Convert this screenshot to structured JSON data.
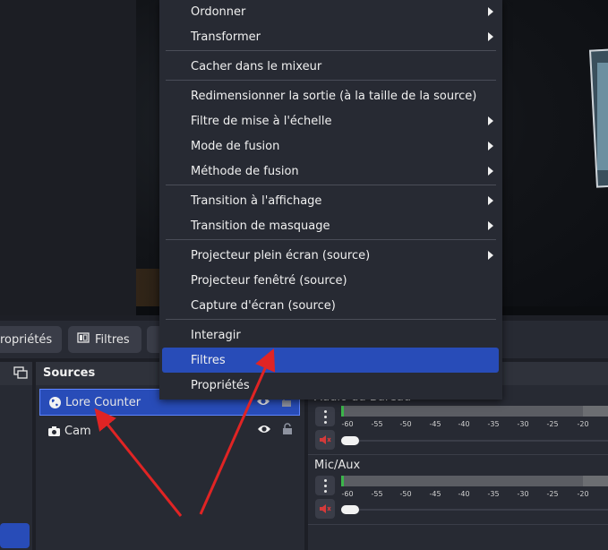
{
  "context_menu": {
    "items": [
      {
        "label": "Ordonner",
        "submenu": true
      },
      {
        "label": "Transformer",
        "submenu": true
      },
      {
        "label": "Cacher dans le mixeur",
        "submenu": false
      },
      {
        "label": "Redimensionner la sortie (à la taille de la source)",
        "submenu": false
      },
      {
        "label": "Filtre de mise à l'échelle",
        "submenu": true
      },
      {
        "label": "Mode de fusion",
        "submenu": true
      },
      {
        "label": "Méthode de fusion",
        "submenu": true
      },
      {
        "label": "Transition à l'affichage",
        "submenu": true
      },
      {
        "label": "Transition de masquage",
        "submenu": true
      },
      {
        "label": "Projecteur plein écran (source)",
        "submenu": true
      },
      {
        "label": "Projecteur fenêtré (source)",
        "submenu": false
      },
      {
        "label": "Capture d'écran (source)",
        "submenu": false
      },
      {
        "label": "Interagir",
        "submenu": false
      },
      {
        "label": "Filtres",
        "submenu": false,
        "active": true
      },
      {
        "label": "Propriétés",
        "submenu": false
      }
    ]
  },
  "toolbar": {
    "properties_label": "ropriétés",
    "filters_label": "Filtres"
  },
  "sources": {
    "title": "Sources",
    "items": [
      {
        "name": "Lore Counter",
        "icon": "browser-globe-icon",
        "selected": true
      },
      {
        "name": "Cam",
        "icon": "camera-icon",
        "selected": false
      }
    ]
  },
  "mixer": {
    "channels": [
      {
        "name": "Audio du Bureau",
        "muted": true
      },
      {
        "name": "Mic/Aux",
        "muted": true
      }
    ],
    "ticks": [
      "-60",
      "-55",
      "-50",
      "-45",
      "-40",
      "-35",
      "-30",
      "-25",
      "-20"
    ]
  },
  "colors": {
    "accent": "#284cb8",
    "annotation_arrow": "#e02424",
    "mute_red": "#d43a3a",
    "meter_green": "#3bb54a"
  }
}
